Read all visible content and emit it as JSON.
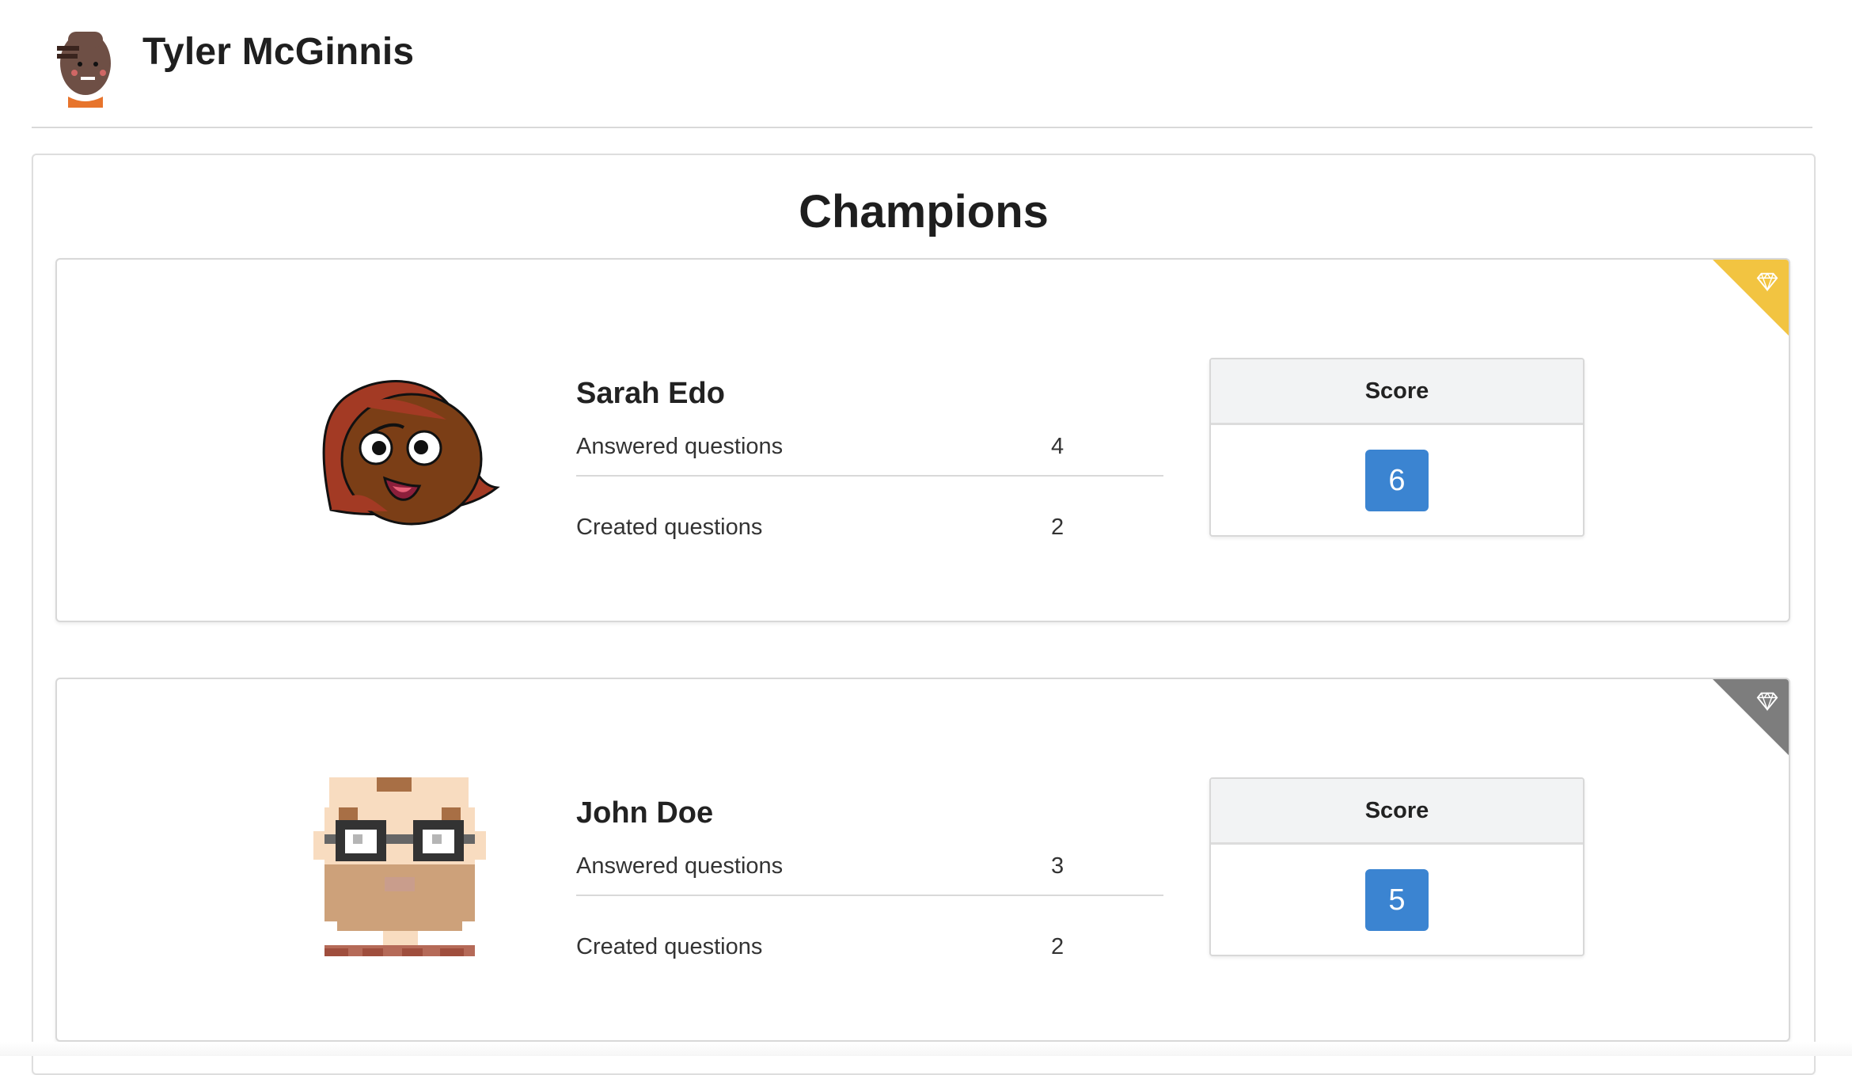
{
  "header": {
    "user_name": "Tyler McGinnis",
    "avatar_icon": "bald-man-avatar-icon"
  },
  "main": {
    "title": "Champions",
    "champions": [
      {
        "name": "Sarah Edo",
        "avatar_icon": "red-haired-cartoon-avatar-icon",
        "ribbon_icon": "diamond-icon",
        "ribbon_color": "#f2c441",
        "answered_label": "Answered questions",
        "answered_value": "4",
        "created_label": "Created questions",
        "created_value": "2",
        "score_label": "Score",
        "score_value": "6"
      },
      {
        "name": "John Doe",
        "avatar_icon": "pixel-glasses-avatar-icon",
        "ribbon_icon": "diamond-icon",
        "ribbon_color": "#7d7d7d",
        "answered_label": "Answered questions",
        "answered_value": "3",
        "created_label": "Created questions",
        "created_value": "2",
        "score_label": "Score",
        "score_value": "5"
      }
    ]
  },
  "colors": {
    "score_badge": "#3b84d1",
    "border": "#d8d8d8",
    "text": "#222222"
  }
}
